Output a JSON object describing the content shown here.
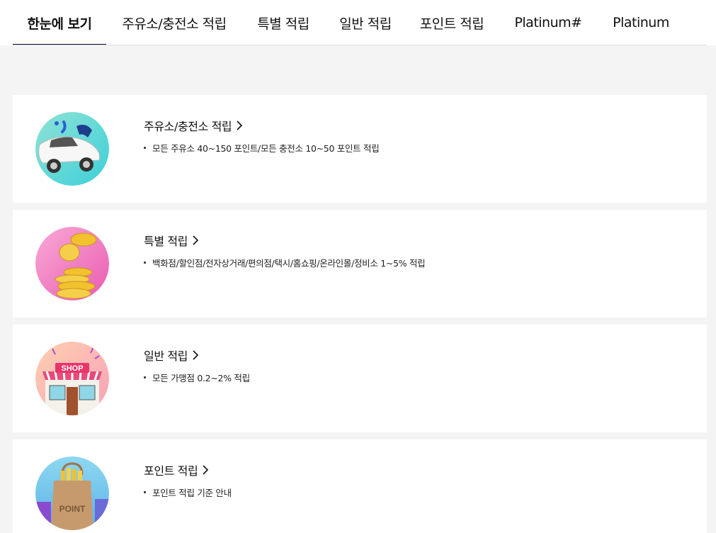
{
  "tabs": [
    {
      "label": "한눈에 보기",
      "active": true
    },
    {
      "label": "주유소/충전소 적립",
      "active": false
    },
    {
      "label": "특별 적립",
      "active": false
    },
    {
      "label": "일반 적립",
      "active": false
    },
    {
      "label": "포인트 적립",
      "active": false
    },
    {
      "label": "Platinum#",
      "active": false
    },
    {
      "label": "Platinum",
      "active": false
    }
  ],
  "colors": {
    "active_underline": "#0a0a3c",
    "page_bg": "#f4f4f4",
    "card_bg": "#ffffff"
  },
  "cards": [
    {
      "title": "주유소/충전소 적립",
      "icon": "gas-station-car-icon",
      "desc": "모든 주유소 40~150 포인트/모든 충전소 10~50 포인트 적립"
    },
    {
      "title": "특별 적립",
      "icon": "gold-coins-icon",
      "desc": "백화점/할인점/전자상거래/편의점/택시/홈쇼핑/온라인몰/정비소 1~5% 적립"
    },
    {
      "title": "일반 적립",
      "icon": "shop-icon",
      "desc": "모든 가맹점 0.2~2% 적립"
    },
    {
      "title": "포인트 적립",
      "icon": "point-bag-icon",
      "desc": "포인트 적립 기준 안내",
      "image_text": "POINT",
      "shop_sign": "SHOP"
    }
  ]
}
